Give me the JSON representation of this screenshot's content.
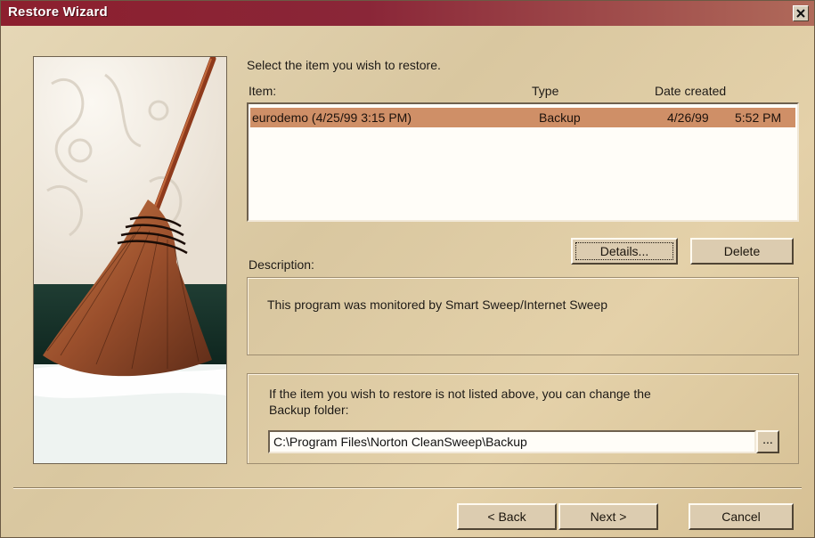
{
  "window": {
    "title": "Restore Wizard",
    "close_glyph": "×"
  },
  "instruction": "Select the item you wish to restore.",
  "list": {
    "headers": {
      "item": "Item:",
      "type": "Type",
      "date": "Date created"
    },
    "rows": [
      {
        "item": "eurodemo (4/25/99 3:15 PM)",
        "type": "Backup",
        "date": "4/26/99",
        "time": "5:52 PM",
        "selected": true
      }
    ]
  },
  "buttons": {
    "details": "Details...",
    "delete": "Delete",
    "back": "< Back",
    "next": "Next >",
    "cancel": "Cancel",
    "browse": "..."
  },
  "description": {
    "label": "Description:",
    "text": "This program was monitored by Smart Sweep/Internet Sweep"
  },
  "folder": {
    "hint_line1": "If the item you wish to restore is not listed above, you can change the",
    "hint_line2": "Backup folder:",
    "path": "C:\\Program Files\\Norton CleanSweep\\Backup"
  },
  "icons": {
    "close": "close-icon",
    "side_image": "broom-icon"
  },
  "colors": {
    "title_bar": "#8c1f2e",
    "selection": "#cf8f67",
    "dialog_bg": "#d9c7a0"
  }
}
